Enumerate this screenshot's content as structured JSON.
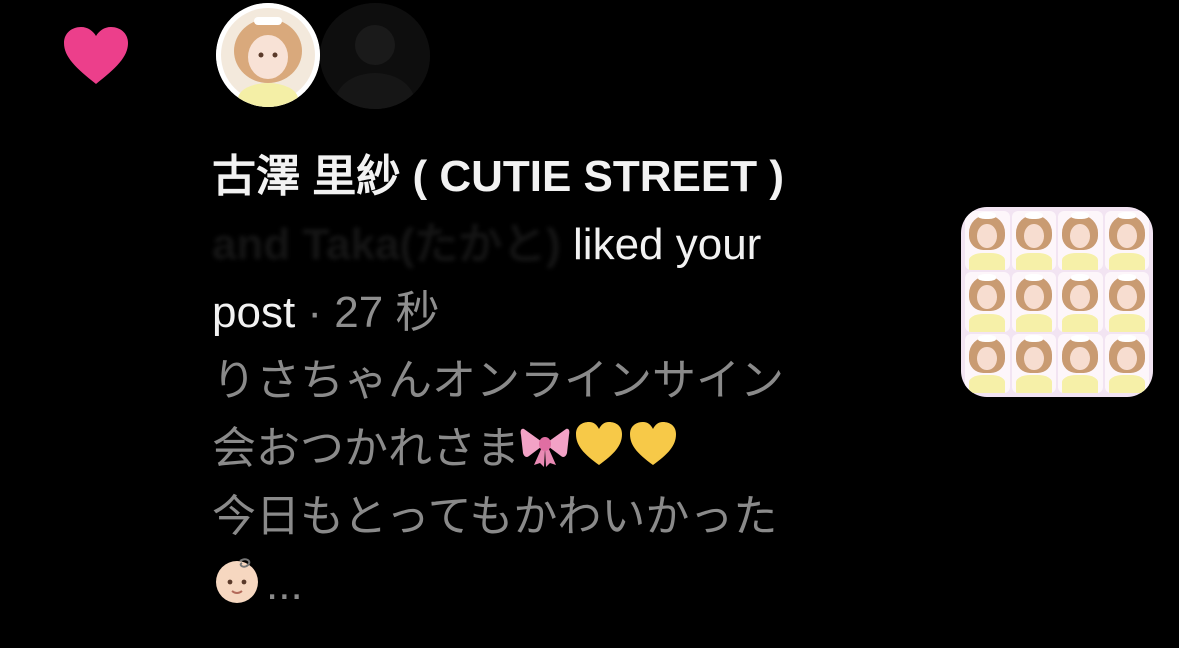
{
  "notification": {
    "type_icon": "heart-icon",
    "username": "古澤 里紗 ( CUTIE STREET )",
    "others_text": "and Taka(たかと)",
    "action_text": "liked your",
    "action_text_2": "post",
    "separator": "·",
    "time": "27 秒",
    "comment_line_1": "りさちゃんオンラインサイン",
    "comment_line_2": "会おつかれさま",
    "comment_line_3": "今日もとってもかわいかった",
    "ellipsis": "..."
  },
  "emojis": {
    "line2": [
      "ribbon-emoji",
      "yellow-heart-emoji",
      "yellow-heart-emoji"
    ],
    "line4": [
      "baby-emoji"
    ]
  },
  "colors": {
    "background": "#000000",
    "heart": "#ec3f8b",
    "primary_text": "#f2f2f2",
    "secondary_text": "#8a8a8a"
  }
}
